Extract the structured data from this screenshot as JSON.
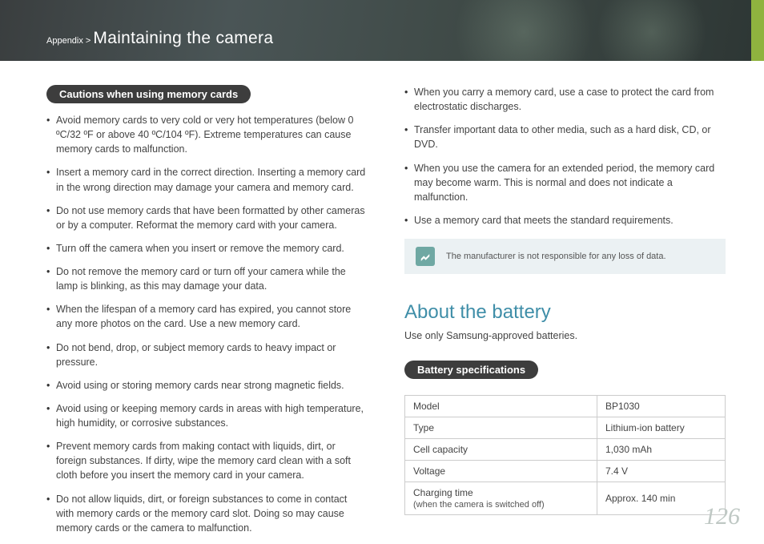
{
  "header": {
    "prefix": "Appendix >",
    "title": "Maintaining the camera"
  },
  "left": {
    "pill": "Cautions when using memory cards",
    "bullets": [
      "Avoid memory cards to very cold or very hot temperatures (below 0 ºC/32 ºF or above 40 ºC/104 ºF). Extreme temperatures can cause memory cards to malfunction.",
      "Insert a memory card in the correct direction. Inserting a memory card in the wrong direction may damage your camera and memory card.",
      "Do not use memory cards that have been formatted by other cameras or by a computer. Reformat the memory card with your camera.",
      "Turn off the camera when you insert or remove the memory card.",
      "Do not remove the memory card or turn off your camera while the lamp is blinking, as this may damage your data.",
      "When the lifespan of a memory card has expired, you cannot store any more photos on the card. Use a new memory card.",
      "Do not bend, drop, or subject memory cards to heavy impact or pressure.",
      "Avoid using or storing memory cards near strong magnetic fields.",
      "Avoid using or keeping memory cards in areas with high temperature, high humidity, or corrosive substances.",
      "Prevent memory cards from making contact with liquids, dirt, or foreign substances. If dirty, wipe the memory card clean with a soft cloth before you insert the memory card in your camera.",
      "Do not allow liquids, dirt, or foreign substances to come in contact with memory cards or the memory card slot. Doing so may cause memory cards or the camera to malfunction."
    ]
  },
  "right": {
    "bullets": [
      "When you carry a memory card, use a case to protect the card from electrostatic discharges.",
      "Transfer important data to other media, such as a hard disk, CD, or DVD.",
      "When you use the camera for an extended period, the memory card may become warm. This is normal and does not indicate a malfunction.",
      "Use a memory card that meets the standard requirements."
    ],
    "note": "The manufacturer is not responsible for any loss of data.",
    "section_title": "About the battery",
    "section_sub": "Use only Samsung-approved batteries.",
    "spec_pill": "Battery specifications",
    "specs": [
      {
        "label": "Model",
        "sub": "",
        "value": "BP1030"
      },
      {
        "label": "Type",
        "sub": "",
        "value": "Lithium-ion battery"
      },
      {
        "label": "Cell capacity",
        "sub": "",
        "value": "1,030 mAh"
      },
      {
        "label": "Voltage",
        "sub": "",
        "value": "7.4 V"
      },
      {
        "label": "Charging time",
        "sub": "(when the camera is switched off)",
        "value": "Approx. 140 min"
      }
    ]
  },
  "page_number": "126"
}
